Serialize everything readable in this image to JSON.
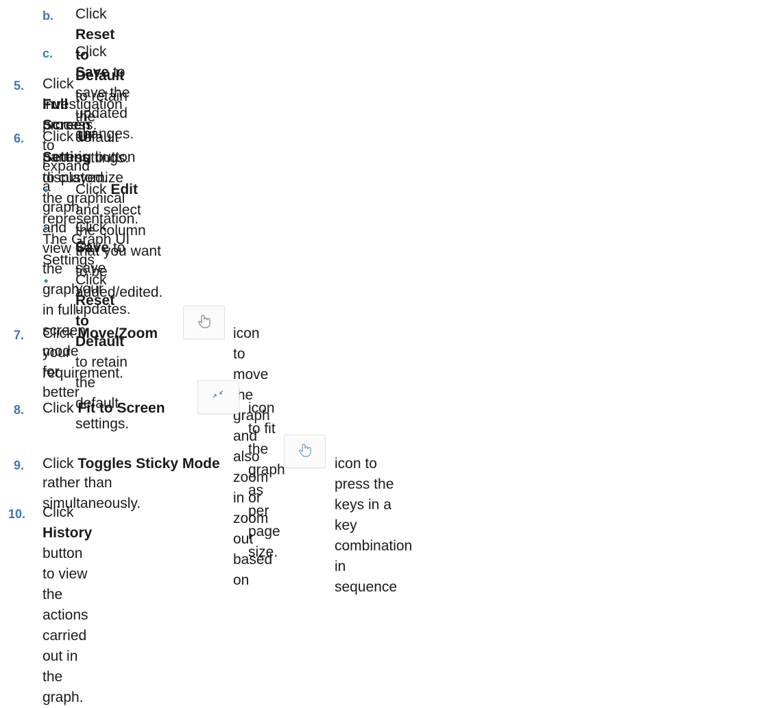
{
  "steps": [
    {
      "num": "b.",
      "pre": "Click ",
      "bold": "Reset to Default",
      "post": " to retain the default settings."
    },
    {
      "num": "c.",
      "pre": "Click ",
      "bold": "Save",
      "post": " to save the updated changes."
    },
    {
      "num": "5.",
      "pre": "Click ",
      "bold": "Full Screen",
      "post": " to expand a graph and view the graph in full-screen mode for better",
      "line2": "investigation process."
    },
    {
      "num": "6.",
      "pre": "Click ",
      "bold": "UI Setting",
      "post": " button to customize the graphical representation. The Graph UI Settings",
      "line2": "pane is displayed."
    },
    {
      "num": "7.",
      "pre": "Click ",
      "bold": "Move/Zoom",
      "post": " icon to move the graph and also zoom in or zoom out based on",
      "line2": "your requirement.",
      "icon": "hand-icon"
    },
    {
      "num": "8.",
      "pre": "Click ",
      "bold": "Fit to Screen",
      "post": " icon to fit the graph as per page size.",
      "icon": "fit-to-screen-icon"
    },
    {
      "num": "9.",
      "pre": "Click ",
      "bold": "Toggles Sticky Mode",
      "post": " icon to press the keys in a key combination in sequence",
      "line2": "rather than simultaneously.",
      "icon": "sticky-hand-icon"
    },
    {
      "num": "10.",
      "pre": "Click ",
      "bold": "History",
      "post": " button to view the actions carried out in the graph."
    }
  ],
  "bullets": [
    {
      "pre": "Click ",
      "bold": "Edit",
      "post": " and select the column that you want to be added/edited."
    },
    {
      "pre": "Click ",
      "bold": "Save",
      "post": " to save your updates.",
      "line2": "Or"
    },
    {
      "pre": "Click ",
      "bold": "Reset to Default",
      "post": " to retain the default settings."
    }
  ],
  "bullet_char": "•",
  "colors": {
    "accent": "#3c78b4",
    "text": "#1a1a1a"
  }
}
